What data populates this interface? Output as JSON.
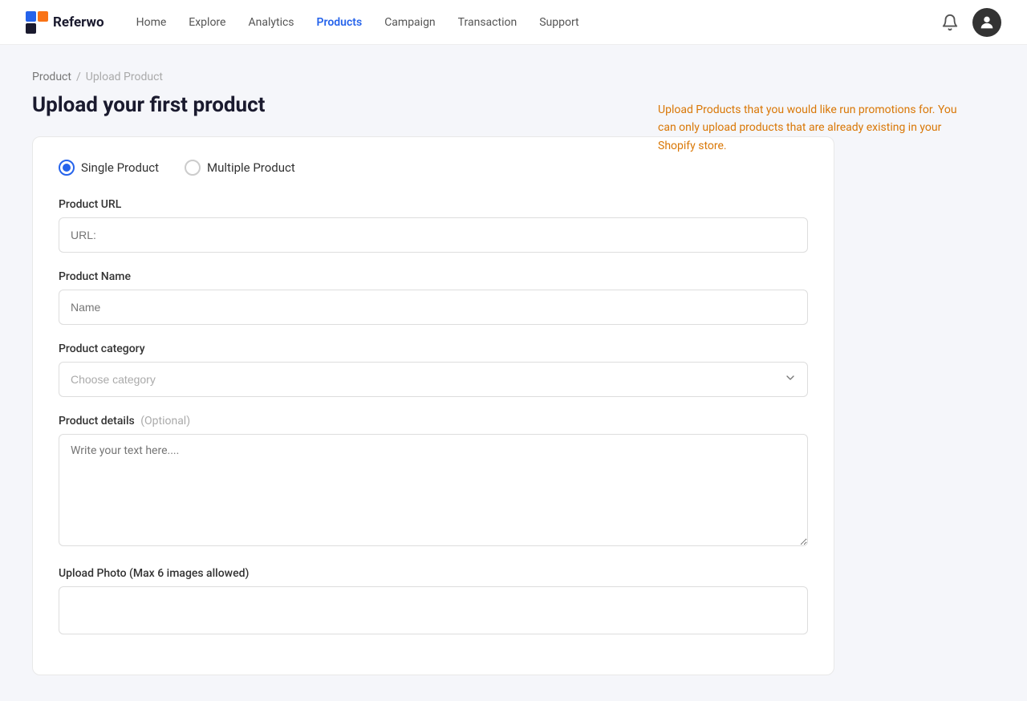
{
  "brand": {
    "name": "Referwo"
  },
  "nav": {
    "links": [
      {
        "id": "home",
        "label": "Home",
        "active": false
      },
      {
        "id": "explore",
        "label": "Explore",
        "active": false
      },
      {
        "id": "analytics",
        "label": "Analytics",
        "active": false
      },
      {
        "id": "products",
        "label": "Products",
        "active": true
      },
      {
        "id": "campaign",
        "label": "Campaign",
        "active": false
      },
      {
        "id": "transaction",
        "label": "Transaction",
        "active": false
      },
      {
        "id": "support",
        "label": "Support",
        "active": false
      }
    ]
  },
  "breadcrumb": {
    "parent": "Product",
    "current": "Upload Product",
    "separator": "/"
  },
  "page": {
    "title": "Upload your first product"
  },
  "info_box": {
    "text": "Upload Products that you would like run promotions for. You can only upload products that are already existing in your Shopify store."
  },
  "form": {
    "product_type": {
      "options": [
        {
          "id": "single",
          "label": "Single Product",
          "checked": true
        },
        {
          "id": "multiple",
          "label": "Multiple Product",
          "checked": false
        }
      ]
    },
    "product_url": {
      "label": "Product URL",
      "placeholder": "URL:"
    },
    "product_name": {
      "label": "Product Name",
      "placeholder": "Name"
    },
    "product_category": {
      "label": "Product category",
      "placeholder": "Choose category"
    },
    "product_details": {
      "label": "Product details",
      "optional": "(Optional)",
      "placeholder": "Write your text here...."
    },
    "upload_photo": {
      "label": "Upload Photo (Max 6 images allowed)"
    }
  }
}
